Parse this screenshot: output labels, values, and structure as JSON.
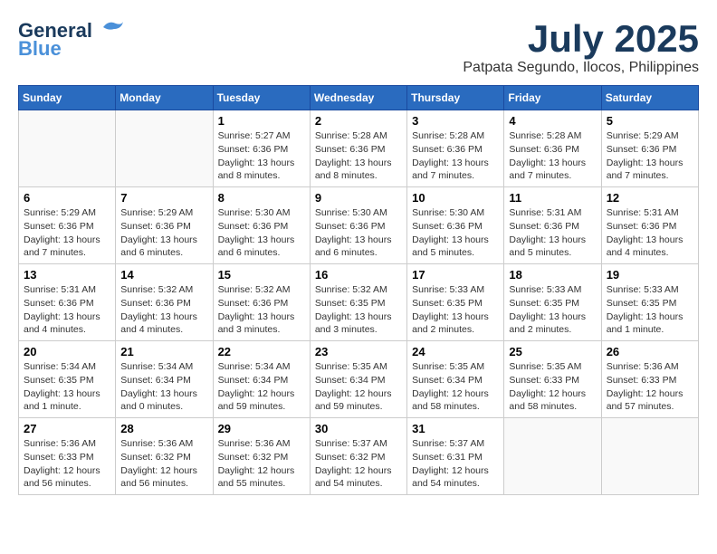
{
  "header": {
    "logo_line1": "General",
    "logo_line2": "Blue",
    "month_year": "July 2025",
    "location": "Patpata Segundo, Ilocos, Philippines"
  },
  "weekdays": [
    "Sunday",
    "Monday",
    "Tuesday",
    "Wednesday",
    "Thursday",
    "Friday",
    "Saturday"
  ],
  "weeks": [
    [
      {
        "day": "",
        "info": ""
      },
      {
        "day": "",
        "info": ""
      },
      {
        "day": "1",
        "info": "Sunrise: 5:27 AM\nSunset: 6:36 PM\nDaylight: 13 hours and 8 minutes."
      },
      {
        "day": "2",
        "info": "Sunrise: 5:28 AM\nSunset: 6:36 PM\nDaylight: 13 hours and 8 minutes."
      },
      {
        "day": "3",
        "info": "Sunrise: 5:28 AM\nSunset: 6:36 PM\nDaylight: 13 hours and 7 minutes."
      },
      {
        "day": "4",
        "info": "Sunrise: 5:28 AM\nSunset: 6:36 PM\nDaylight: 13 hours and 7 minutes."
      },
      {
        "day": "5",
        "info": "Sunrise: 5:29 AM\nSunset: 6:36 PM\nDaylight: 13 hours and 7 minutes."
      }
    ],
    [
      {
        "day": "6",
        "info": "Sunrise: 5:29 AM\nSunset: 6:36 PM\nDaylight: 13 hours and 7 minutes."
      },
      {
        "day": "7",
        "info": "Sunrise: 5:29 AM\nSunset: 6:36 PM\nDaylight: 13 hours and 6 minutes."
      },
      {
        "day": "8",
        "info": "Sunrise: 5:30 AM\nSunset: 6:36 PM\nDaylight: 13 hours and 6 minutes."
      },
      {
        "day": "9",
        "info": "Sunrise: 5:30 AM\nSunset: 6:36 PM\nDaylight: 13 hours and 6 minutes."
      },
      {
        "day": "10",
        "info": "Sunrise: 5:30 AM\nSunset: 6:36 PM\nDaylight: 13 hours and 5 minutes."
      },
      {
        "day": "11",
        "info": "Sunrise: 5:31 AM\nSunset: 6:36 PM\nDaylight: 13 hours and 5 minutes."
      },
      {
        "day": "12",
        "info": "Sunrise: 5:31 AM\nSunset: 6:36 PM\nDaylight: 13 hours and 4 minutes."
      }
    ],
    [
      {
        "day": "13",
        "info": "Sunrise: 5:31 AM\nSunset: 6:36 PM\nDaylight: 13 hours and 4 minutes."
      },
      {
        "day": "14",
        "info": "Sunrise: 5:32 AM\nSunset: 6:36 PM\nDaylight: 13 hours and 4 minutes."
      },
      {
        "day": "15",
        "info": "Sunrise: 5:32 AM\nSunset: 6:36 PM\nDaylight: 13 hours and 3 minutes."
      },
      {
        "day": "16",
        "info": "Sunrise: 5:32 AM\nSunset: 6:35 PM\nDaylight: 13 hours and 3 minutes."
      },
      {
        "day": "17",
        "info": "Sunrise: 5:33 AM\nSunset: 6:35 PM\nDaylight: 13 hours and 2 minutes."
      },
      {
        "day": "18",
        "info": "Sunrise: 5:33 AM\nSunset: 6:35 PM\nDaylight: 13 hours and 2 minutes."
      },
      {
        "day": "19",
        "info": "Sunrise: 5:33 AM\nSunset: 6:35 PM\nDaylight: 13 hours and 1 minute."
      }
    ],
    [
      {
        "day": "20",
        "info": "Sunrise: 5:34 AM\nSunset: 6:35 PM\nDaylight: 13 hours and 1 minute."
      },
      {
        "day": "21",
        "info": "Sunrise: 5:34 AM\nSunset: 6:34 PM\nDaylight: 13 hours and 0 minutes."
      },
      {
        "day": "22",
        "info": "Sunrise: 5:34 AM\nSunset: 6:34 PM\nDaylight: 12 hours and 59 minutes."
      },
      {
        "day": "23",
        "info": "Sunrise: 5:35 AM\nSunset: 6:34 PM\nDaylight: 12 hours and 59 minutes."
      },
      {
        "day": "24",
        "info": "Sunrise: 5:35 AM\nSunset: 6:34 PM\nDaylight: 12 hours and 58 minutes."
      },
      {
        "day": "25",
        "info": "Sunrise: 5:35 AM\nSunset: 6:33 PM\nDaylight: 12 hours and 58 minutes."
      },
      {
        "day": "26",
        "info": "Sunrise: 5:36 AM\nSunset: 6:33 PM\nDaylight: 12 hours and 57 minutes."
      }
    ],
    [
      {
        "day": "27",
        "info": "Sunrise: 5:36 AM\nSunset: 6:33 PM\nDaylight: 12 hours and 56 minutes."
      },
      {
        "day": "28",
        "info": "Sunrise: 5:36 AM\nSunset: 6:32 PM\nDaylight: 12 hours and 56 minutes."
      },
      {
        "day": "29",
        "info": "Sunrise: 5:36 AM\nSunset: 6:32 PM\nDaylight: 12 hours and 55 minutes."
      },
      {
        "day": "30",
        "info": "Sunrise: 5:37 AM\nSunset: 6:32 PM\nDaylight: 12 hours and 54 minutes."
      },
      {
        "day": "31",
        "info": "Sunrise: 5:37 AM\nSunset: 6:31 PM\nDaylight: 12 hours and 54 minutes."
      },
      {
        "day": "",
        "info": ""
      },
      {
        "day": "",
        "info": ""
      }
    ]
  ]
}
